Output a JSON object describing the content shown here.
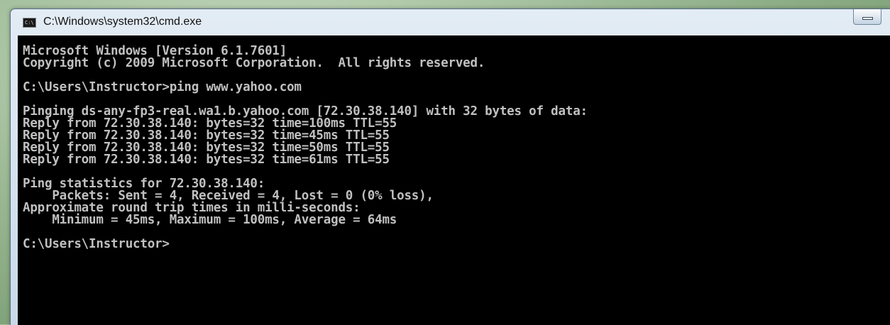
{
  "window": {
    "title": "C:\\Windows\\system32\\cmd.exe",
    "icon_name": "cmd-icon",
    "icon_text": "C:\\"
  },
  "console": {
    "lines": [
      "Microsoft Windows [Version 6.1.7601]",
      "Copyright (c) 2009 Microsoft Corporation.  All rights reserved.",
      "",
      "C:\\Users\\Instructor>ping www.yahoo.com",
      "",
      "Pinging ds-any-fp3-real.wa1.b.yahoo.com [72.30.38.140] with 32 bytes of data:",
      "Reply from 72.30.38.140: bytes=32 time=100ms TTL=55",
      "Reply from 72.30.38.140: bytes=32 time=45ms TTL=55",
      "Reply from 72.30.38.140: bytes=32 time=50ms TTL=55",
      "Reply from 72.30.38.140: bytes=32 time=61ms TTL=55",
      "",
      "Ping statistics for 72.30.38.140:",
      "    Packets: Sent = 4, Received = 4, Lost = 0 (0% loss),",
      "Approximate round trip times in milli-seconds:",
      "    Minimum = 45ms, Maximum = 100ms, Average = 64ms",
      "",
      "C:\\Users\\Instructor>"
    ]
  },
  "colors": {
    "console_bg": "#000000",
    "console_fg": "#c0c0c0"
  }
}
